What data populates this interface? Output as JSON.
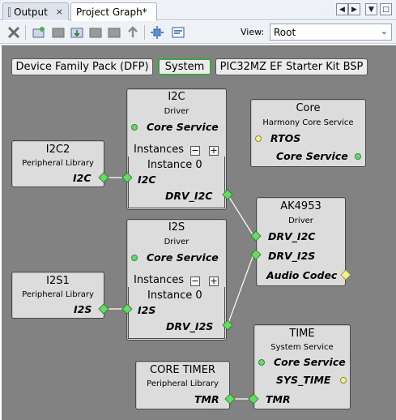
{
  "tabs": [
    {
      "label": "Output",
      "close": "×"
    },
    {
      "label": "Project Graph*"
    }
  ],
  "toolbar": {
    "view_label": "View:",
    "view_value": "Root"
  },
  "top_buttons": [
    {
      "label": "Device Family Pack (DFP)"
    },
    {
      "label": "System"
    },
    {
      "label": "PIC32MZ EF Starter Kit BSP"
    }
  ],
  "nodes": {
    "i2c_driver": {
      "title": "I2C",
      "subtitle": "Driver",
      "port": "Core Service",
      "instances_label": "Instances",
      "instance_label": "Instance 0",
      "in_port": "I2C",
      "out_port": "DRV_I2C"
    },
    "i2c2": {
      "title": "I2C2",
      "subtitle": "Peripheral Library",
      "port": "I2C"
    },
    "core": {
      "title": "Core",
      "subtitle": "Harmony Core Service",
      "port1": "RTOS",
      "port2": "Core Service"
    },
    "i2s_driver": {
      "title": "I2S",
      "subtitle": "Driver",
      "port": "Core Service",
      "instances_label": "Instances",
      "instance_label": "Instance 0",
      "in_port": "I2S",
      "out_port": "DRV_I2S"
    },
    "ak4953": {
      "title": "AK4953",
      "subtitle": "Driver",
      "port1": "DRV_I2C",
      "port2": "DRV_I2S",
      "port3": "Audio Codec"
    },
    "i2s1": {
      "title": "I2S1",
      "subtitle": "Peripheral Library",
      "port": "I2S"
    },
    "time": {
      "title": "TIME",
      "subtitle": "System Service",
      "port1": "Core Service",
      "port2": "SYS_TIME",
      "port3": "TMR"
    },
    "core_timer": {
      "title": "CORE TIMER",
      "subtitle": "Peripheral Library",
      "port": "TMR"
    }
  },
  "pm": {
    "minus": "−",
    "plus": "+"
  },
  "colors": {
    "canvas": "#828282",
    "node": "#dcdcdc",
    "connector_green": "#5ee05e",
    "connector_yellow": "#f4f08a",
    "selected_border": "#3fa33f"
  }
}
